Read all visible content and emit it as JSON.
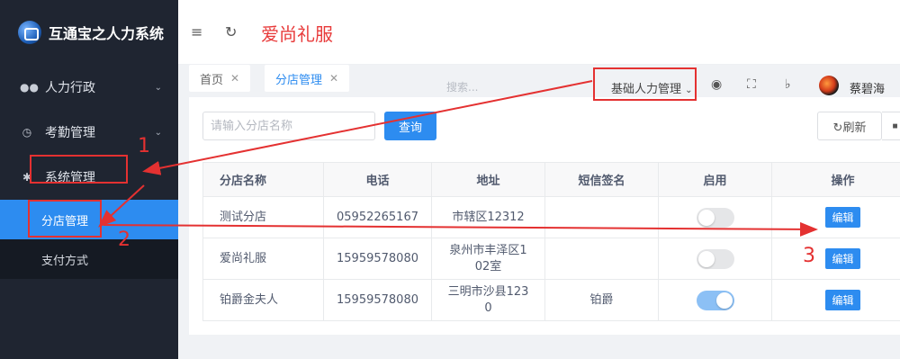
{
  "app": {
    "logo_text": "互通宝之人力系统"
  },
  "sidebar": {
    "items": [
      {
        "label": "人力行政",
        "icon": "users-icon"
      },
      {
        "label": "考勤管理",
        "icon": "clock-icon"
      },
      {
        "label": "系统管理",
        "icon": "gear-icon"
      }
    ],
    "sub_items": [
      {
        "label": "分店管理",
        "active": true
      },
      {
        "label": "支付方式",
        "active": false
      }
    ]
  },
  "header": {
    "shop_title": "爱尚礼服"
  },
  "tabs": [
    {
      "label": "首页"
    },
    {
      "label": "分店管理"
    }
  ],
  "topbar": {
    "search_placeholder": "搜索...",
    "module_select": "基础人力管理",
    "username": "蔡碧海"
  },
  "toolbar": {
    "search_placeholder": "请输入分店名称",
    "query_label": "查询",
    "refresh_label": "刷新"
  },
  "table": {
    "headers": [
      "分店名称",
      "电话",
      "地址",
      "短信签名",
      "启用",
      "操作"
    ],
    "rows": [
      {
        "name": "测试分店",
        "phone": "05952265167",
        "address": "市辖区12312",
        "sms": "",
        "enabled": false,
        "action": "编辑"
      },
      {
        "name": "爱尚礼服",
        "phone": "15959578080",
        "address": "泉州市丰泽区1\n02室",
        "sms": "",
        "enabled": false,
        "action": "编辑"
      },
      {
        "name": "铂爵金夫人",
        "phone": "15959578080",
        "address": "三明市沙县123\n0",
        "sms": "铂爵",
        "enabled": true,
        "action": "编辑"
      }
    ]
  },
  "annotations": {
    "n1": "1",
    "n2": "2",
    "n3": "3",
    "color": "#e43131"
  },
  "colors": {
    "primary": "#2d8cf0",
    "sidebar_bg": "#1f2531",
    "title_red": "#e83a3a"
  }
}
